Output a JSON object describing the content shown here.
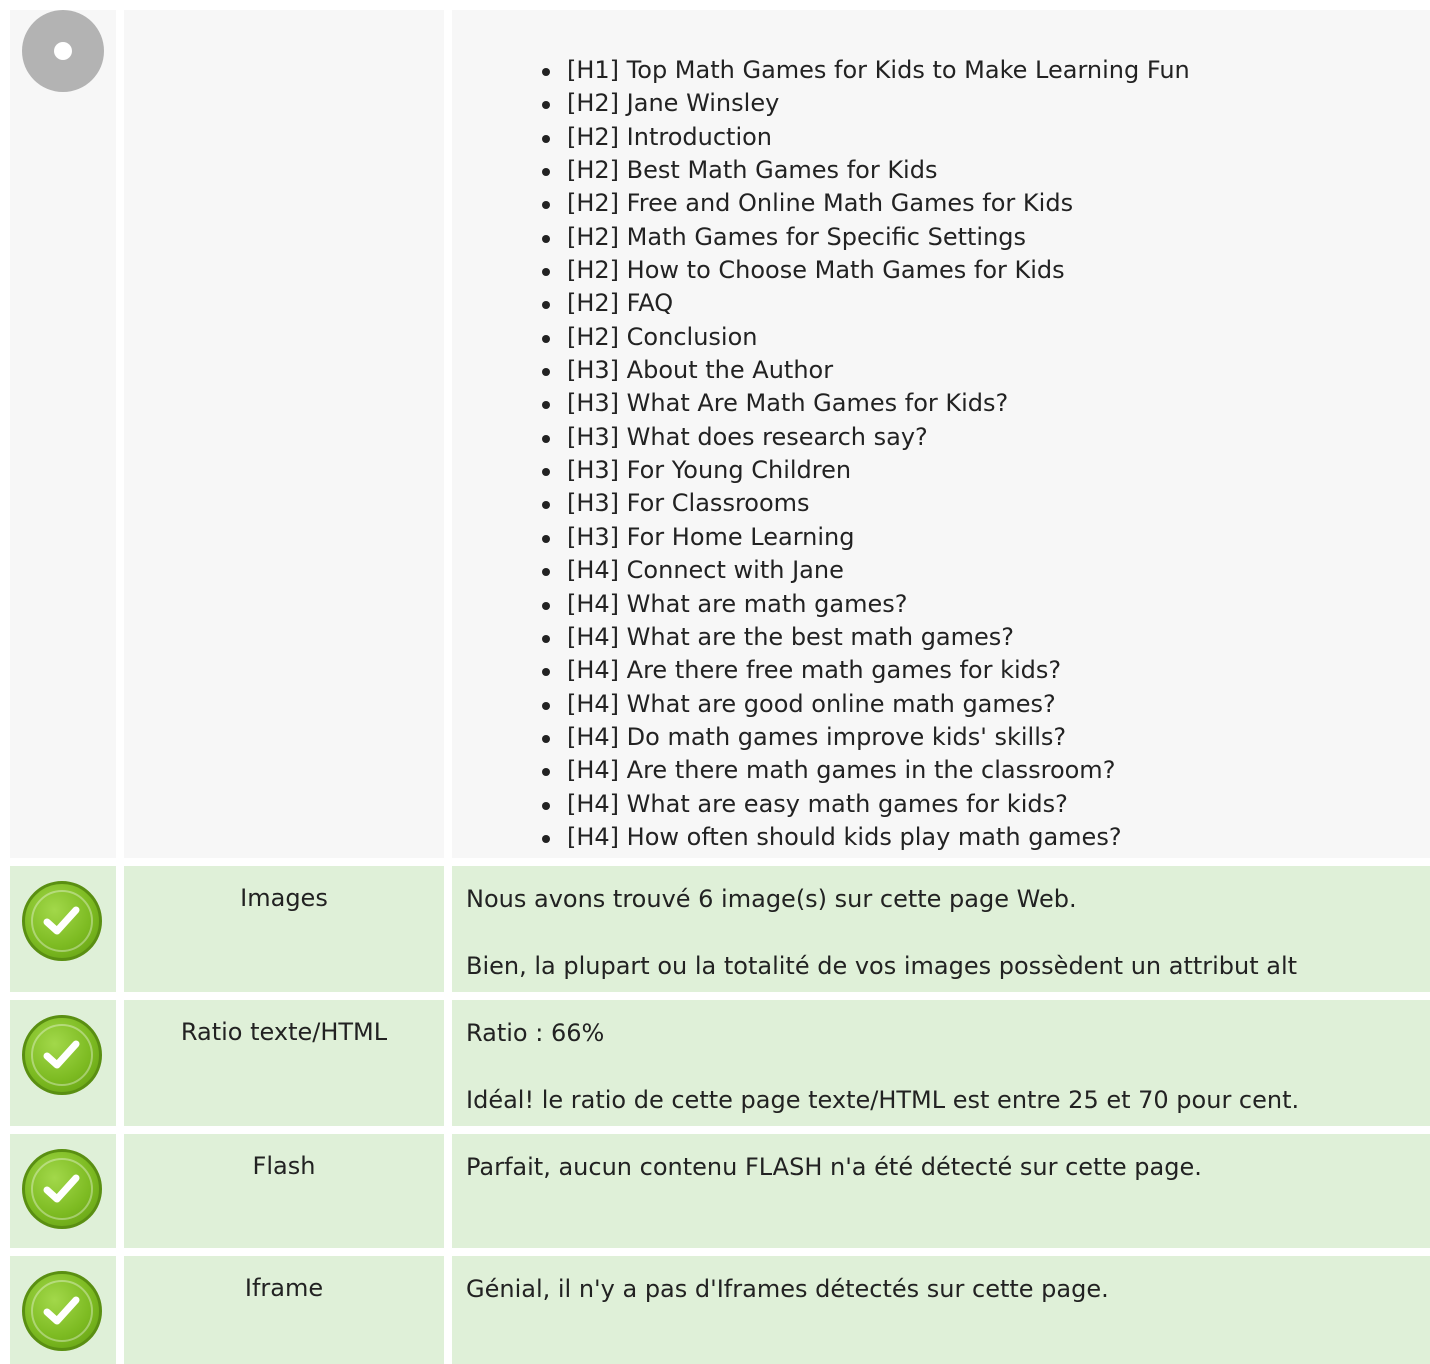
{
  "headings_row": {
    "items": [
      "[H1] Top Math Games for Kids to Make Learning Fun",
      "[H2] Jane Winsley",
      "[H2] Introduction",
      "[H2] Best Math Games for Kids",
      "[H2] Free and Online Math Games for Kids",
      "[H2] Math Games for Specific Settings",
      "[H2] How to Choose Math Games for Kids",
      "[H2] FAQ",
      "[H2] Conclusion",
      "[H3] About the Author",
      "[H3] What Are Math Games for Kids?",
      "[H3] What does research say?",
      "[H3] For Young Children",
      "[H3] For Classrooms",
      "[H3] For Home Learning",
      "[H4] Connect with Jane",
      "[H4] What are math games?",
      "[H4] What are the best math games?",
      "[H4] Are there free math games for kids?",
      "[H4] What are good online math games?",
      "[H4] Do math games improve kids' skills?",
      "[H4] Are there math games in the classroom?",
      "[H4] What are easy math games for kids?",
      "[H4] How often should kids play math games?"
    ]
  },
  "checks": [
    {
      "label": "Images",
      "lines": [
        "Nous avons trouvé 6 image(s) sur cette page Web.",
        "Bien, la plupart ou la totalité de vos images possèdent un attribut alt"
      ]
    },
    {
      "label": "Ratio texte/HTML",
      "lines": [
        "Ratio : 66%",
        "Idéal! le ratio de cette page texte/HTML est entre 25 et 70 pour cent."
      ]
    },
    {
      "label": "Flash",
      "lines": [
        "Parfait, aucun contenu FLASH n'a été détecté sur cette page."
      ]
    },
    {
      "label": "Iframe",
      "lines": [
        "Génial, il n'y a pas d'Iframes détectés sur cette page."
      ]
    }
  ],
  "colors": {
    "neutral_row_bg": "#f7f7f7",
    "ok_row_bg": "#dff0d8",
    "ok_icon": "#7dbb22",
    "neutral_icon": "#b3b3b3"
  }
}
